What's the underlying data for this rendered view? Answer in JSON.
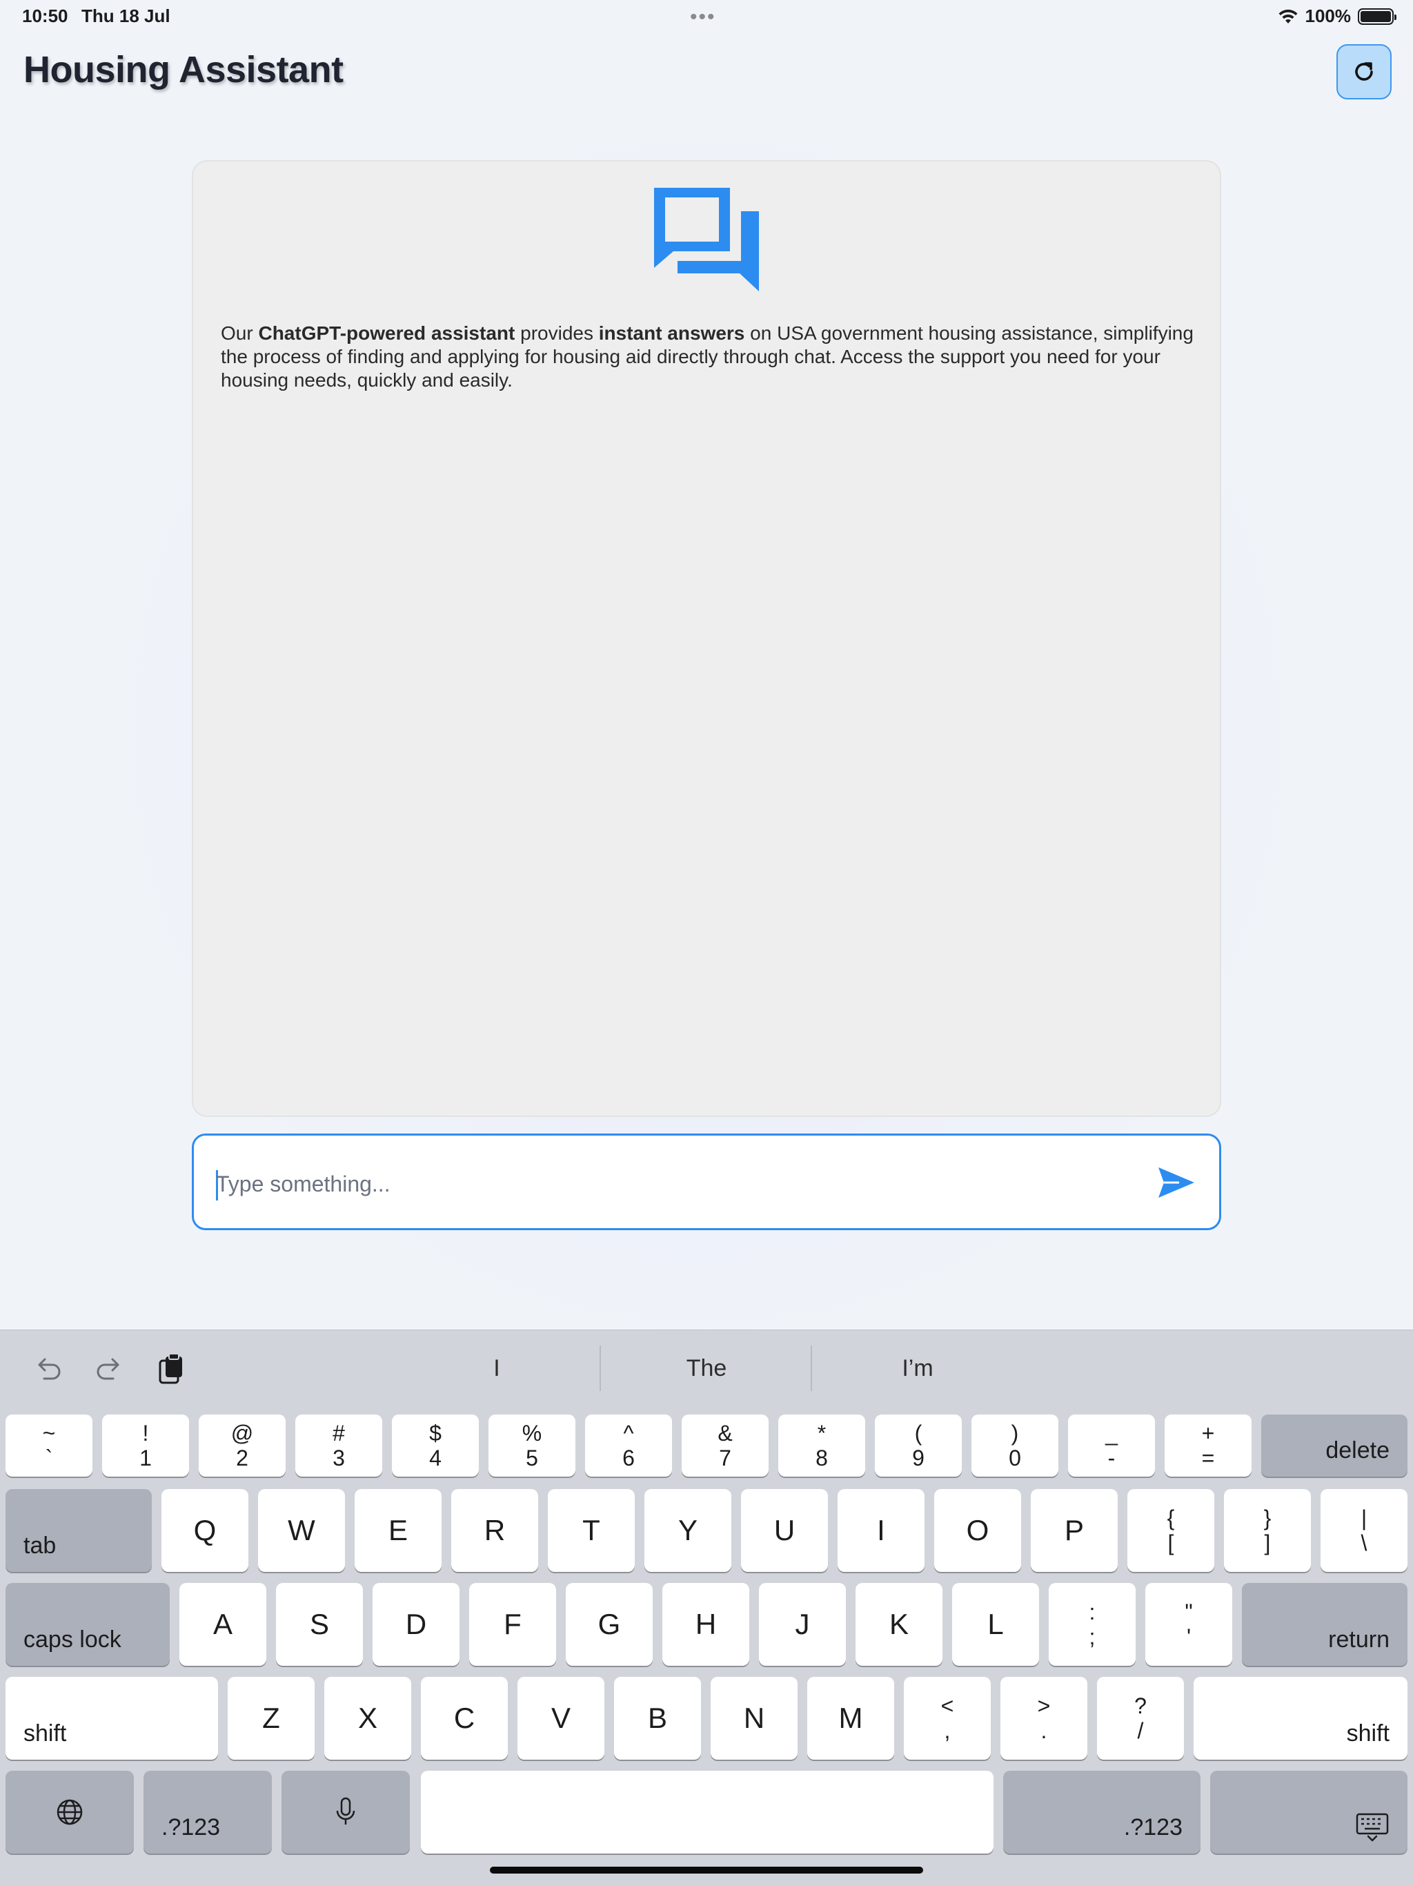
{
  "status_bar": {
    "time": "10:50",
    "date": "Thu 18 Jul",
    "battery": "100%"
  },
  "header": {
    "title": "Housing Assistant",
    "refresh_icon": "refresh-icon"
  },
  "chat": {
    "icon": "chat-bubbles-icon",
    "intro": {
      "p1": "Our ",
      "b1": "ChatGPT-powered assistant",
      "p2": " provides ",
      "b2": "instant answers",
      "p3": " on USA government housing assistance, simplifying the process of finding and applying for housing aid directly through chat. Access the support you need for your housing needs, quickly and easily."
    }
  },
  "input": {
    "placeholder": "Type something...",
    "send_icon": "send-icon"
  },
  "keyboard": {
    "toolbar": {
      "undo_icon": "undo-icon",
      "redo_icon": "redo-icon",
      "paste_icon": "paste-icon",
      "suggestions": [
        "I",
        "The",
        "I’m"
      ]
    },
    "number_row": [
      {
        "top": "~",
        "bottom": "`"
      },
      {
        "top": "!",
        "bottom": "1"
      },
      {
        "top": "@",
        "bottom": "2"
      },
      {
        "top": "#",
        "bottom": "3"
      },
      {
        "top": "$",
        "bottom": "4"
      },
      {
        "top": "%",
        "bottom": "5"
      },
      {
        "top": "^",
        "bottom": "6"
      },
      {
        "top": "&",
        "bottom": "7"
      },
      {
        "top": "*",
        "bottom": "8"
      },
      {
        "top": "(",
        "bottom": "9"
      },
      {
        "top": ")",
        "bottom": "0"
      },
      {
        "top": "_",
        "bottom": "-"
      },
      {
        "top": "+",
        "bottom": "="
      }
    ],
    "delete": "delete",
    "tab": "tab",
    "row_q": [
      "Q",
      "W",
      "E",
      "R",
      "T",
      "Y",
      "U",
      "I",
      "O",
      "P"
    ],
    "row_q_symbols": [
      {
        "top": "{",
        "bottom": "["
      },
      {
        "top": "}",
        "bottom": "]"
      },
      {
        "top": "|",
        "bottom": "\\"
      }
    ],
    "caps_lock": "caps lock",
    "row_a": [
      "A",
      "S",
      "D",
      "F",
      "G",
      "H",
      "J",
      "K",
      "L"
    ],
    "row_a_symbols": [
      {
        "top": ":",
        "bottom": ";"
      },
      {
        "top": "\"",
        "bottom": "'"
      }
    ],
    "return": "return",
    "shift": "shift",
    "row_z": [
      "Z",
      "X",
      "C",
      "V",
      "B",
      "N",
      "M"
    ],
    "row_z_symbols": [
      {
        "top": "<",
        "bottom": ","
      },
      {
        "top": ">",
        "bottom": "."
      },
      {
        "top": "?",
        "bottom": "/"
      }
    ],
    "numbers_key": ".?123",
    "globe_icon": "globe-icon",
    "mic_icon": "microphone-icon",
    "hide_keyboard_icon": "hide-keyboard-icon"
  }
}
